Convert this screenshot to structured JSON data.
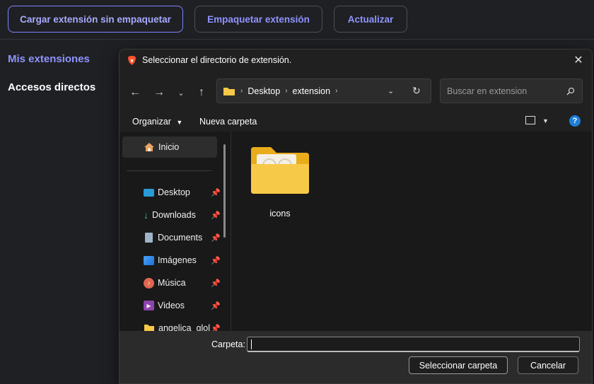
{
  "page": {
    "buttons": {
      "load_unpacked": "Cargar extensión sin empaquetar",
      "pack": "Empaquetar extensión",
      "update": "Actualizar"
    },
    "sidebar": {
      "my_extensions": "Mis extensiones",
      "shortcuts": "Accesos directos"
    }
  },
  "dialog": {
    "title": "Seleccionar el directorio de extensión.",
    "breadcrumb": [
      "Desktop",
      "extension"
    ],
    "search_placeholder": "Buscar en extension",
    "toolbar": {
      "organize": "Organizar",
      "new_folder": "Nueva carpeta"
    },
    "nav": [
      {
        "label": "Inicio",
        "icon": "home-icon"
      },
      {
        "label": "Desktop",
        "icon": "desktop-icon"
      },
      {
        "label": "Downloads",
        "icon": "download-icon"
      },
      {
        "label": "Documents",
        "icon": "document-icon"
      },
      {
        "label": "Imágenes",
        "icon": "pictures-icon"
      },
      {
        "label": "Música",
        "icon": "music-icon"
      },
      {
        "label": "Videos",
        "icon": "videos-icon"
      },
      {
        "label": "angelica_glol",
        "icon": "folder-icon"
      }
    ],
    "files": [
      {
        "name": "icons",
        "icon": "folder-icon"
      }
    ],
    "footer": {
      "folder_label": "Carpeta:",
      "folder_value": "",
      "select_button": "Seleccionar carpeta",
      "cancel_button": "Cancelar"
    }
  },
  "colors": {
    "accent": "#8f93ff",
    "folder": "#f7c948"
  }
}
